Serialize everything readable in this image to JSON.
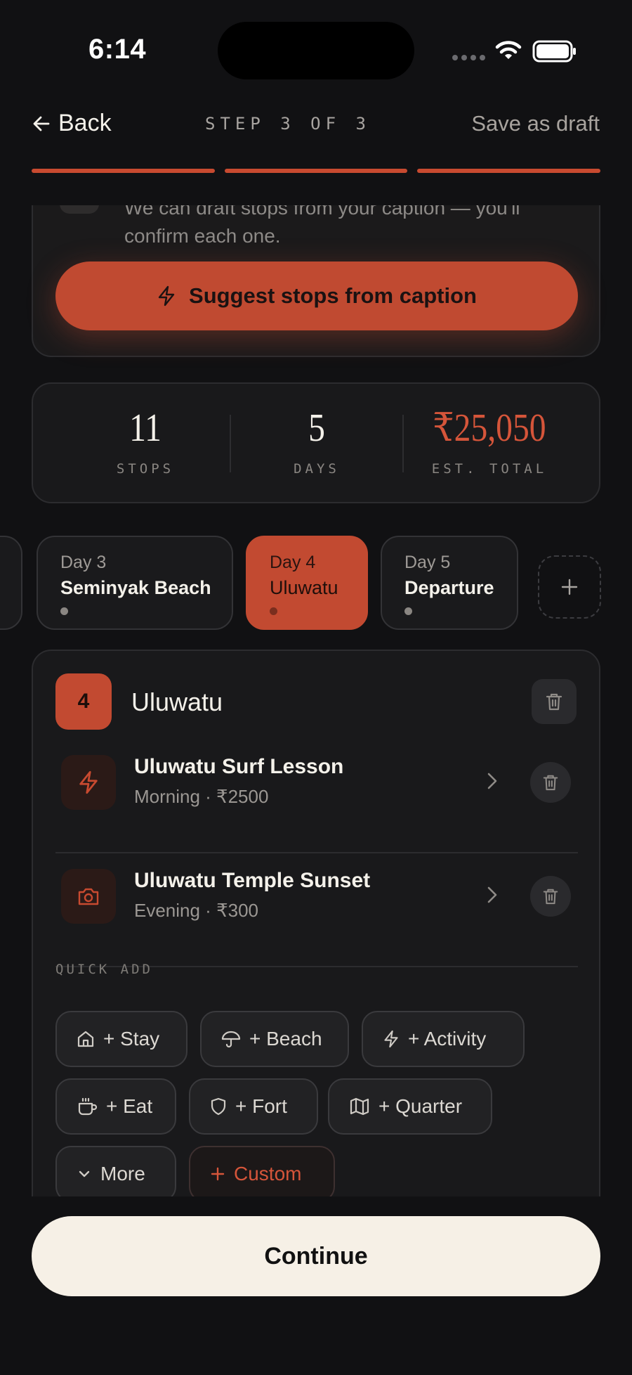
{
  "status_bar": {
    "time": "6:14"
  },
  "nav": {
    "back_label": "Back",
    "step_label": "STEP 3 OF 3",
    "save_draft_label": "Save as draft",
    "progress_segments_complete": 3,
    "progress_segments_total": 3
  },
  "suggest": {
    "line1": "We can draft stops from your caption — you'll",
    "line2": "confirm each one.",
    "button_label": "Suggest stops from caption"
  },
  "stats": [
    {
      "value": "11",
      "label": "STOPS"
    },
    {
      "value": "5",
      "label": "DAYS"
    },
    {
      "value": "₹25,050",
      "label": "EST. TOTAL"
    }
  ],
  "day_tabs": [
    {
      "day": "Day 3",
      "name": "Seminyak Beach",
      "active": false
    },
    {
      "day": "Day 4",
      "name": "Uluwatu",
      "active": true
    },
    {
      "day": "Day 5",
      "name": "Departure",
      "active": false
    }
  ],
  "day_detail": {
    "number": "4",
    "title": "Uluwatu",
    "stops": [
      {
        "title": "Uluwatu Surf Lesson",
        "meta": "Morning · ₹2500",
        "icon": "bolt-icon"
      },
      {
        "title": "Uluwatu Temple Sunset",
        "meta": "Evening · ₹300",
        "icon": "camera-icon"
      }
    ],
    "quick_add_label": "QUICK ADD",
    "quick_add": [
      {
        "label": "+ Stay",
        "icon": "home-icon"
      },
      {
        "label": "+ Beach",
        "icon": "umbrella-icon"
      },
      {
        "label": "+ Activity",
        "icon": "bolt-icon"
      },
      {
        "label": "+ Eat",
        "icon": "cup-icon"
      },
      {
        "label": "+ Fort",
        "icon": "shield-icon"
      },
      {
        "label": "+ Quarter",
        "icon": "map-icon"
      },
      {
        "label": "More",
        "icon": "chevron-down-icon"
      },
      {
        "label": "Custom",
        "icon": "plus-icon"
      }
    ]
  },
  "continue_label": "Continue",
  "colors": {
    "accent": "#c24a31",
    "background": "#111113",
    "continue_bg": "#f6f0e6"
  }
}
